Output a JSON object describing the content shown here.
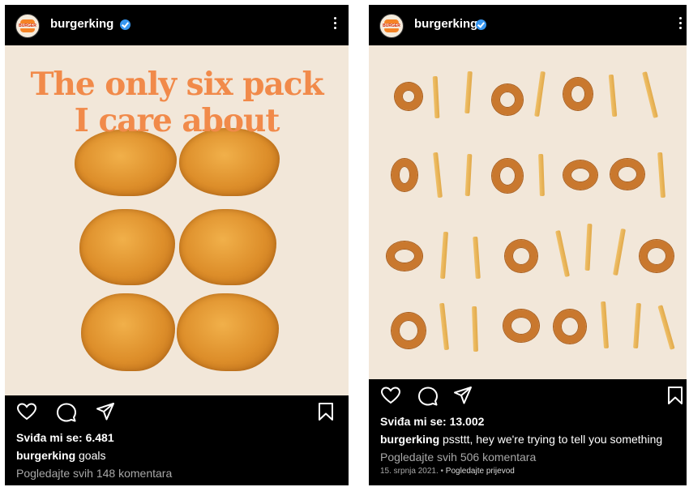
{
  "posts": [
    {
      "username": "burgerking",
      "avatar_logo_text": "BURGER KING",
      "headline_line1": "The only six pack",
      "headline_line2": "I care about",
      "likes": "Sviđa mi se: 6.481",
      "caption_user": "burgerking",
      "caption_text": " goals",
      "comments_link": "Pogledajte svih 148 komentara"
    },
    {
      "username": "burgerking",
      "avatar_logo_text": "BURGER KING",
      "likes": "Sviđa mi se: 13.002",
      "caption_user": "burgerking",
      "caption_text": " pssttt, hey we're trying to tell you something",
      "comments_link": "Pogledajte svih 506 komentara",
      "date": "15. srpnja 2021.",
      "date_separator": " • ",
      "translate": "Pogledajte prijevod"
    }
  ],
  "icons": [
    "verified-badge-icon",
    "more-options-icon",
    "heart-icon",
    "comment-icon",
    "share-icon",
    "bookmark-icon"
  ],
  "colors": {
    "background": "#000000",
    "image_background": "#f2e7d9",
    "headline": "#f18a4a",
    "verified": "#3897f0",
    "secondary_text": "#a8a8a8"
  }
}
